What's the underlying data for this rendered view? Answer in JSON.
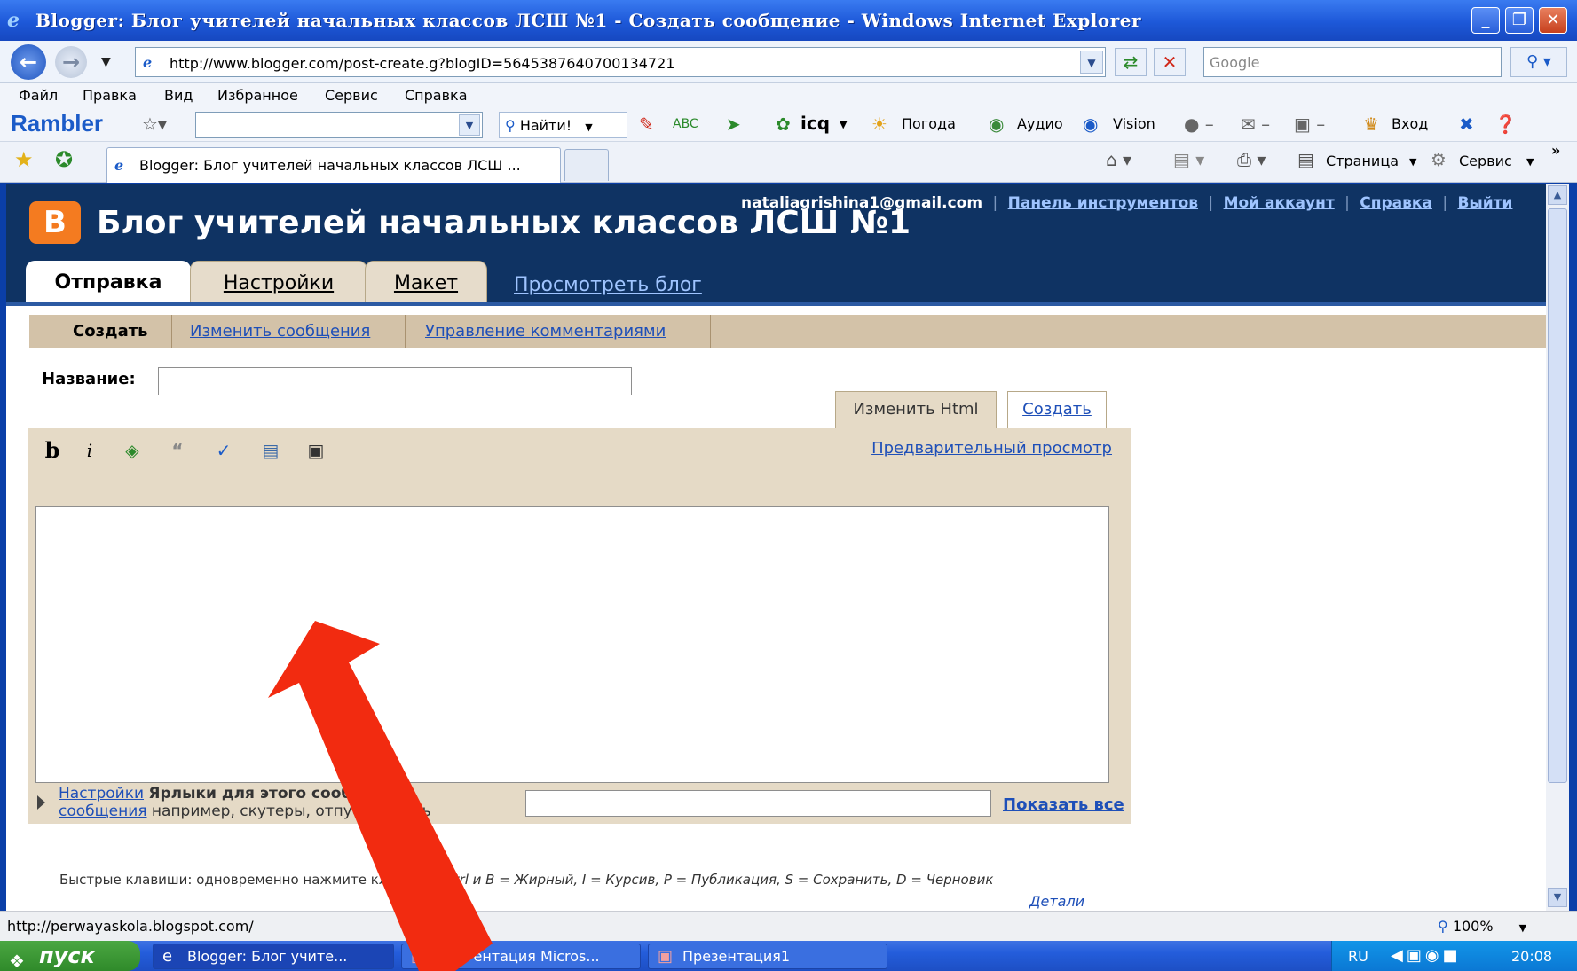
{
  "window": {
    "title": "Blogger: Блог учителей начальных классов ЛСШ №1 - Создать сообщение - Windows Internet Explorer",
    "minimize": "_",
    "maximize": "❐",
    "close": "✕"
  },
  "address": {
    "url": "http://www.blogger.com/post-create.g?blogID=5645387640700134721",
    "search_placeholder": "Google"
  },
  "menu": [
    "Файл",
    "Правка",
    "Вид",
    "Избранное",
    "Сервис",
    "Справка"
  ],
  "rambler": {
    "logo": "Rambler",
    "find_label": "Найти!",
    "icq": "icq",
    "weather": "Погода",
    "audio": "Аудио",
    "vision": "Vision",
    "login": "Вход"
  },
  "browser_tab": {
    "label": "Blogger: Блог учителей начальных классов ЛСШ ...",
    "page_cmd": "Страница",
    "service_cmd": "Сервис"
  },
  "blog": {
    "logo_letter": "B",
    "title": "Блог учителей начальных классов ЛСШ №1",
    "user_email": "nataliagrishina1@gmail.com",
    "links": [
      "Панель инструментов",
      "Мой аккаунт",
      "Справка",
      "Выйти"
    ],
    "tabs": [
      "Отправка",
      "Настройки",
      "Макет"
    ],
    "view_blog": "Просмотреть блог",
    "subnav": [
      "Создать",
      "Изменить сообщения",
      "Управление комментариями"
    ]
  },
  "editor": {
    "title_label": "Название:",
    "title_value": "",
    "mode_html": "Изменить Html",
    "mode_compose": "Создать",
    "preview": "Предварительный просмотр",
    "toolbar": {
      "bold": "b",
      "italic": "i"
    },
    "body_value": ""
  },
  "labels": {
    "settings_link_1": "Настройки",
    "settings_link_2": "сообщения",
    "labels_title": "Ярлыки для этого сообще",
    "labels_hint": "например, скутеры, отпус",
    "labels_tail": "ь",
    "show_all": "Показать все"
  },
  "shortcuts": {
    "intro": "Быстрые клавиши: одновременно нажмите кл",
    "keys": "Ctrl и B = Жирный, I = Курсив, P = Публикация, S = Сохранить, D = Черновик",
    "details": "Детали"
  },
  "status": {
    "url": "http://perwayaskola.blogspot.com/",
    "zoom": "100%"
  },
  "taskbar": {
    "start": "пуск",
    "tasks": [
      "Blogger: Блог учите...",
      "Пр... ентация Micros...",
      "Презентация1"
    ],
    "lang": "RU",
    "clock": "20:08"
  },
  "colors": {
    "blog_header": "#0f3363",
    "accent_beige": "#e5dac6",
    "link": "#1e4fb8",
    "arrow": "#f22b10"
  }
}
